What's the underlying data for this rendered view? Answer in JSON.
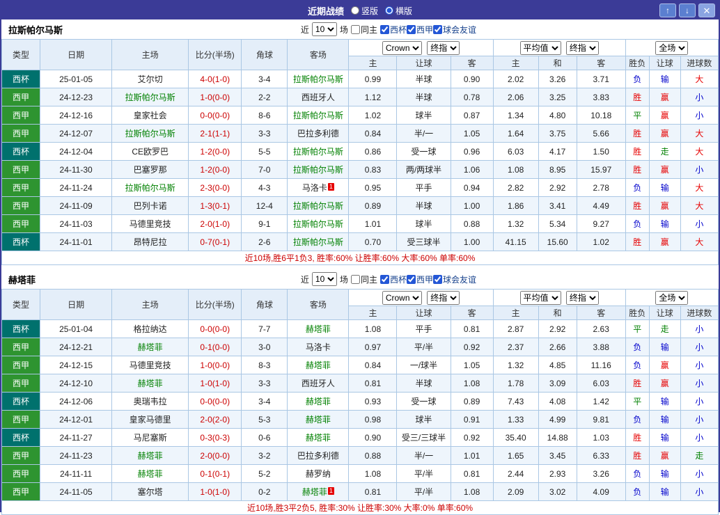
{
  "titlebar": {
    "title": "近期战绩",
    "vertical": {
      "label": "竖版",
      "checked": false
    },
    "horizontal": {
      "label": "横版",
      "checked": true
    },
    "up_icon": "↑",
    "down_icon": "↓",
    "close_icon": "✕"
  },
  "filters": {
    "near": "近",
    "count": "10",
    "games": "场",
    "same_home": {
      "label": "同主",
      "checked": false
    },
    "leagues": [
      {
        "label": "西杯",
        "checked": true
      },
      {
        "label": "西甲",
        "checked": true
      },
      {
        "label": "球会友谊",
        "checked": true
      }
    ]
  },
  "table_header": {
    "type": "类型",
    "date": "日期",
    "home": "主场",
    "score_half": "比分(半场)",
    "corner": "角球",
    "away": "客场",
    "selects": {
      "company": "Crown",
      "final": "终指",
      "average": "平均值",
      "final2": "终指",
      "fulltime": "全场"
    },
    "sub": {
      "home_odds": "主",
      "handicap": "让球",
      "away_odds": "客",
      "avg_home": "主",
      "avg_draw": "和",
      "avg_away": "客",
      "result": "胜负",
      "handicap_result": "让球",
      "goals": "进球数"
    }
  },
  "colors": {
    "titlebar-bg": "#3b3b97",
    "cup-badge": "#00716d",
    "liga-badge": "#2e9430",
    "focus-team": "#008000",
    "score-red": "#cc0000",
    "result-red": "#e60000",
    "result-blue": "#0000cc",
    "result-green": "#008000",
    "table-border": "#aac7e4",
    "header-bg": "#e4eef9",
    "alt-row-bg": "#eef5fc",
    "summary-red": "#cc0000"
  },
  "teams": [
    {
      "name": "拉斯帕尔马斯",
      "summary": "近10场,胜6平1负3, 胜率:60% 让胜率:60% 大率:60% 单率:60%",
      "rows": [
        {
          "league": "西杯",
          "date": "25-01-05",
          "home": "艾尔切",
          "homeFocus": false,
          "homeRed": "",
          "score": "4-0(1-0)",
          "corner": "3-4",
          "away": "拉斯帕尔马斯",
          "awayFocus": true,
          "awayRed": "",
          "oddsHome": "0.99",
          "line": "半球",
          "oddsAway": "0.90",
          "avgHome": "2.02",
          "avgDraw": "3.26",
          "avgAway": "3.71",
          "res": "负",
          "letRes": "输",
          "goalRes": "大"
        },
        {
          "league": "西甲",
          "date": "24-12-23",
          "home": "拉斯帕尔马斯",
          "homeFocus": true,
          "homeRed": "",
          "score": "1-0(0-0)",
          "corner": "2-2",
          "away": "西班牙人",
          "awayFocus": false,
          "awayRed": "",
          "oddsHome": "1.12",
          "line": "半球",
          "oddsAway": "0.78",
          "avgHome": "2.06",
          "avgDraw": "3.25",
          "avgAway": "3.83",
          "res": "胜",
          "letRes": "赢",
          "goalRes": "小"
        },
        {
          "league": "西甲",
          "date": "24-12-16",
          "home": "皇家社会",
          "homeFocus": false,
          "homeRed": "",
          "score": "0-0(0-0)",
          "corner": "8-6",
          "away": "拉斯帕尔马斯",
          "awayFocus": true,
          "awayRed": "",
          "oddsHome": "1.02",
          "line": "球半",
          "oddsAway": "0.87",
          "avgHome": "1.34",
          "avgDraw": "4.80",
          "avgAway": "10.18",
          "res": "平",
          "letRes": "赢",
          "goalRes": "小"
        },
        {
          "league": "西甲",
          "date": "24-12-07",
          "home": "拉斯帕尔马斯",
          "homeFocus": true,
          "homeRed": "",
          "score": "2-1(1-1)",
          "corner": "3-3",
          "away": "巴拉多利德",
          "awayFocus": false,
          "awayRed": "",
          "oddsHome": "0.84",
          "line": "半/一",
          "oddsAway": "1.05",
          "avgHome": "1.64",
          "avgDraw": "3.75",
          "avgAway": "5.66",
          "res": "胜",
          "letRes": "赢",
          "goalRes": "大"
        },
        {
          "league": "西杯",
          "date": "24-12-04",
          "home": "CE欧罗巴",
          "homeFocus": false,
          "homeRed": "",
          "score": "1-2(0-0)",
          "corner": "5-5",
          "away": "拉斯帕尔马斯",
          "awayFocus": true,
          "awayRed": "",
          "oddsHome": "0.86",
          "line": "受一球",
          "oddsAway": "0.96",
          "avgHome": "6.03",
          "avgDraw": "4.17",
          "avgAway": "1.50",
          "res": "胜",
          "letRes": "走",
          "goalRes": "大"
        },
        {
          "league": "西甲",
          "date": "24-11-30",
          "home": "巴塞罗那",
          "homeFocus": false,
          "homeRed": "",
          "score": "1-2(0-0)",
          "corner": "7-0",
          "away": "拉斯帕尔马斯",
          "awayFocus": true,
          "awayRed": "",
          "oddsHome": "0.83",
          "line": "两/两球半",
          "oddsAway": "1.06",
          "avgHome": "1.08",
          "avgDraw": "8.95",
          "avgAway": "15.97",
          "res": "胜",
          "letRes": "赢",
          "goalRes": "小"
        },
        {
          "league": "西甲",
          "date": "24-11-24",
          "home": "拉斯帕尔马斯",
          "homeFocus": true,
          "homeRed": "",
          "score": "2-3(0-0)",
          "corner": "4-3",
          "away": "马洛卡",
          "awayFocus": false,
          "awayRed": "1",
          "oddsHome": "0.95",
          "line": "平手",
          "oddsAway": "0.94",
          "avgHome": "2.82",
          "avgDraw": "2.92",
          "avgAway": "2.78",
          "res": "负",
          "letRes": "输",
          "goalRes": "大"
        },
        {
          "league": "西甲",
          "date": "24-11-09",
          "home": "巴列卡诺",
          "homeFocus": false,
          "homeRed": "",
          "score": "1-3(0-1)",
          "corner": "12-4",
          "away": "拉斯帕尔马斯",
          "awayFocus": true,
          "awayRed": "",
          "oddsHome": "0.89",
          "line": "半球",
          "oddsAway": "1.00",
          "avgHome": "1.86",
          "avgDraw": "3.41",
          "avgAway": "4.49",
          "res": "胜",
          "letRes": "赢",
          "goalRes": "大"
        },
        {
          "league": "西甲",
          "date": "24-11-03",
          "home": "马德里竞技",
          "homeFocus": false,
          "homeRed": "",
          "score": "2-0(1-0)",
          "corner": "9-1",
          "away": "拉斯帕尔马斯",
          "awayFocus": true,
          "awayRed": "",
          "oddsHome": "1.01",
          "line": "球半",
          "oddsAway": "0.88",
          "avgHome": "1.32",
          "avgDraw": "5.34",
          "avgAway": "9.27",
          "res": "负",
          "letRes": "输",
          "goalRes": "小"
        },
        {
          "league": "西杯",
          "date": "24-11-01",
          "home": "昂特尼拉",
          "homeFocus": false,
          "homeRed": "",
          "score": "0-7(0-1)",
          "corner": "2-6",
          "away": "拉斯帕尔马斯",
          "awayFocus": true,
          "awayRed": "",
          "oddsHome": "0.70",
          "line": "受三球半",
          "oddsAway": "1.00",
          "avgHome": "41.15",
          "avgDraw": "15.60",
          "avgAway": "1.02",
          "res": "胜",
          "letRes": "赢",
          "goalRes": "大"
        }
      ]
    },
    {
      "name": "赫塔菲",
      "summary": "近10场,胜3平2负5, 胜率:30% 让胜率:30% 大率:0% 单率:60%",
      "rows": [
        {
          "league": "西杯",
          "date": "25-01-04",
          "home": "格拉纳达",
          "homeFocus": false,
          "homeRed": "",
          "score": "0-0(0-0)",
          "corner": "7-7",
          "away": "赫塔菲",
          "awayFocus": true,
          "awayRed": "",
          "oddsHome": "1.08",
          "line": "平手",
          "oddsAway": "0.81",
          "avgHome": "2.87",
          "avgDraw": "2.92",
          "avgAway": "2.63",
          "res": "平",
          "letRes": "走",
          "goalRes": "小"
        },
        {
          "league": "西甲",
          "date": "24-12-21",
          "home": "赫塔菲",
          "homeFocus": true,
          "homeRed": "",
          "score": "0-1(0-0)",
          "corner": "3-0",
          "away": "马洛卡",
          "awayFocus": false,
          "awayRed": "",
          "oddsHome": "0.97",
          "line": "平/半",
          "oddsAway": "0.92",
          "avgHome": "2.37",
          "avgDraw": "2.66",
          "avgAway": "3.88",
          "res": "负",
          "letRes": "输",
          "goalRes": "小"
        },
        {
          "league": "西甲",
          "date": "24-12-15",
          "home": "马德里竞技",
          "homeFocus": false,
          "homeRed": "",
          "score": "1-0(0-0)",
          "corner": "8-3",
          "away": "赫塔菲",
          "awayFocus": true,
          "awayRed": "",
          "oddsHome": "0.84",
          "line": "一/球半",
          "oddsAway": "1.05",
          "avgHome": "1.32",
          "avgDraw": "4.85",
          "avgAway": "11.16",
          "res": "负",
          "letRes": "赢",
          "goalRes": "小"
        },
        {
          "league": "西甲",
          "date": "24-12-10",
          "home": "赫塔菲",
          "homeFocus": true,
          "homeRed": "",
          "score": "1-0(1-0)",
          "corner": "3-3",
          "away": "西班牙人",
          "awayFocus": false,
          "awayRed": "",
          "oddsHome": "0.81",
          "line": "半球",
          "oddsAway": "1.08",
          "avgHome": "1.78",
          "avgDraw": "3.09",
          "avgAway": "6.03",
          "res": "胜",
          "letRes": "赢",
          "goalRes": "小"
        },
        {
          "league": "西杯",
          "date": "24-12-06",
          "home": "奥瑞韦拉",
          "homeFocus": false,
          "homeRed": "",
          "score": "0-0(0-0)",
          "corner": "3-4",
          "away": "赫塔菲",
          "awayFocus": true,
          "awayRed": "",
          "oddsHome": "0.93",
          "line": "受一球",
          "oddsAway": "0.89",
          "avgHome": "7.43",
          "avgDraw": "4.08",
          "avgAway": "1.42",
          "res": "平",
          "letRes": "输",
          "goalRes": "小"
        },
        {
          "league": "西甲",
          "date": "24-12-01",
          "home": "皇家马德里",
          "homeFocus": false,
          "homeRed": "",
          "score": "2-0(2-0)",
          "corner": "5-3",
          "away": "赫塔菲",
          "awayFocus": true,
          "awayRed": "",
          "oddsHome": "0.98",
          "line": "球半",
          "oddsAway": "0.91",
          "avgHome": "1.33",
          "avgDraw": "4.99",
          "avgAway": "9.81",
          "res": "负",
          "letRes": "输",
          "goalRes": "小"
        },
        {
          "league": "西杯",
          "date": "24-11-27",
          "home": "马尼塞斯",
          "homeFocus": false,
          "homeRed": "",
          "score": "0-3(0-3)",
          "corner": "0-6",
          "away": "赫塔菲",
          "awayFocus": true,
          "awayRed": "",
          "oddsHome": "0.90",
          "line": "受三/三球半",
          "oddsAway": "0.92",
          "avgHome": "35.40",
          "avgDraw": "14.88",
          "avgAway": "1.03",
          "res": "胜",
          "letRes": "输",
          "goalRes": "小"
        },
        {
          "league": "西甲",
          "date": "24-11-23",
          "home": "赫塔菲",
          "homeFocus": true,
          "homeRed": "",
          "score": "2-0(0-0)",
          "corner": "3-2",
          "away": "巴拉多利德",
          "awayFocus": false,
          "awayRed": "",
          "oddsHome": "0.88",
          "line": "半/一",
          "oddsAway": "1.01",
          "avgHome": "1.65",
          "avgDraw": "3.45",
          "avgAway": "6.33",
          "res": "胜",
          "letRes": "赢",
          "goalRes": "走"
        },
        {
          "league": "西甲",
          "date": "24-11-11",
          "home": "赫塔菲",
          "homeFocus": true,
          "homeRed": "",
          "score": "0-1(0-1)",
          "corner": "5-2",
          "away": "赫罗纳",
          "awayFocus": false,
          "awayRed": "",
          "oddsHome": "1.08",
          "line": "平/半",
          "oddsAway": "0.81",
          "avgHome": "2.44",
          "avgDraw": "2.93",
          "avgAway": "3.26",
          "res": "负",
          "letRes": "输",
          "goalRes": "小"
        },
        {
          "league": "西甲",
          "date": "24-11-05",
          "home": "塞尔塔",
          "homeFocus": false,
          "homeRed": "",
          "score": "1-0(1-0)",
          "corner": "0-2",
          "away": "赫塔菲",
          "awayFocus": true,
          "awayRed": "1",
          "oddsHome": "0.81",
          "line": "平/半",
          "oddsAway": "1.08",
          "avgHome": "2.09",
          "avgDraw": "3.02",
          "avgAway": "4.09",
          "res": "负",
          "letRes": "输",
          "goalRes": "小"
        }
      ]
    }
  ]
}
